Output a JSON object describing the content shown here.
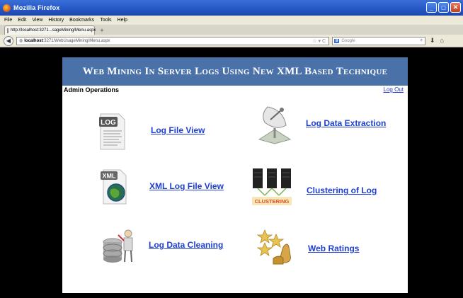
{
  "browser": {
    "window_title": "Mozilla Firefox",
    "menu": [
      "File",
      "Edit",
      "View",
      "History",
      "Bookmarks",
      "Tools",
      "Help"
    ],
    "tab_title": "http://localhost:3271...sageMining/Menu.aspx",
    "new_tab": "+",
    "url_host": "localhost",
    "url_rest": ":3271/WebUsageMining/Menu.aspx",
    "search_engine": "8",
    "search_placeholder": "Google",
    "url_controls": "☆ ▾ C"
  },
  "page": {
    "banner_title": "Web Mining In Server Logs Using New XML Based Technique",
    "section_label": "Admin Operations",
    "logout_label": "Log Out",
    "banner_color": "#4a72a9",
    "link_color": "#1f3fcf"
  },
  "menu_items": [
    {
      "label": "Log File View",
      "icon": "log-file-icon"
    },
    {
      "label": "Log Data Extraction",
      "icon": "satellite-dish-icon"
    },
    {
      "label": "XML Log File View",
      "icon": "xml-file-icon"
    },
    {
      "label": "Clustering of Log",
      "icon": "server-cluster-icon"
    },
    {
      "label": "Log Data Cleaning",
      "icon": "database-cleaning-icon"
    },
    {
      "label": "Web Ratings",
      "icon": "rating-stars-icon"
    }
  ],
  "icon_text": {
    "log": "LOG",
    "xml": "XML",
    "clustering": "CLUSTERING"
  }
}
